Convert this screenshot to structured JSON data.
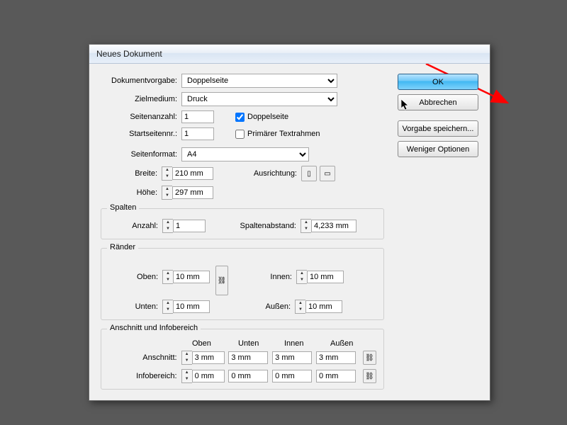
{
  "title": "Neues Dokument",
  "labels": {
    "preset": "Dokumentvorgabe:",
    "intent": "Zielmedium:",
    "pages": "Seitenanzahl:",
    "startpage": "Startseitennr.:",
    "facing": "Doppelseite",
    "primaryframe": "Primärer Textrahmen",
    "pagesize": "Seitenformat:",
    "width": "Breite:",
    "height": "Höhe:",
    "orientation": "Ausrichtung:",
    "columns_group": "Spalten",
    "col_count": "Anzahl:",
    "col_gutter": "Spaltenabstand:",
    "margins_group": "Ränder",
    "top": "Oben:",
    "bottom": "Unten:",
    "inside": "Innen:",
    "outside": "Außen:",
    "bleed_group": "Anschnitt und Infobereich",
    "col_top": "Oben",
    "col_bottom": "Unten",
    "col_inside": "Innen",
    "col_outside": "Außen",
    "bleed": "Anschnitt:",
    "slug": "Infobereich:"
  },
  "values": {
    "preset": "Doppelseite",
    "intent": "Druck",
    "pages": "1",
    "startpage": "1",
    "facing_checked": true,
    "primaryframe_checked": false,
    "pagesize": "A4",
    "width": "210 mm",
    "height": "297 mm",
    "col_count": "1",
    "col_gutter": "4,233 mm",
    "margin_top": "10 mm",
    "margin_bottom": "10 mm",
    "margin_inside": "10 mm",
    "margin_outside": "10 mm",
    "bleed_top": "3 mm",
    "bleed_bottom": "3 mm",
    "bleed_inside": "3 mm",
    "bleed_outside": "3 mm",
    "slug_top": "0 mm",
    "slug_bottom": "0 mm",
    "slug_inside": "0 mm",
    "slug_outside": "0 mm"
  },
  "buttons": {
    "ok": "OK",
    "cancel": "Abbrechen",
    "save": "Vorgabe speichern...",
    "less": "Weniger Optionen"
  }
}
